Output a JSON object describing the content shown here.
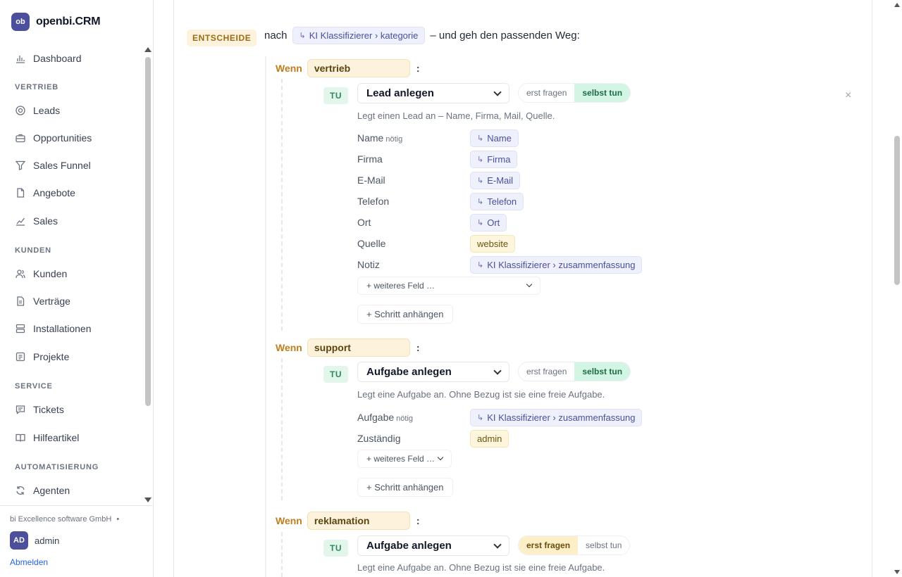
{
  "app": {
    "logo": "ob",
    "name": "openbi.CRM"
  },
  "sidebar": {
    "items": [
      {
        "label": "Dashboard",
        "icon": "bar-chart-icon"
      },
      {
        "section": "VERTRIEB"
      },
      {
        "label": "Leads",
        "icon": "target-icon"
      },
      {
        "label": "Opportunities",
        "icon": "briefcase-icon"
      },
      {
        "label": "Sales Funnel",
        "icon": "funnel-icon"
      },
      {
        "label": "Angebote",
        "icon": "document-icon"
      },
      {
        "label": "Sales",
        "icon": "trend-chart-icon"
      },
      {
        "section": "KUNDEN"
      },
      {
        "label": "Kunden",
        "icon": "users-icon"
      },
      {
        "label": "Verträge",
        "icon": "contract-icon"
      },
      {
        "label": "Installationen",
        "icon": "server-icon"
      },
      {
        "label": "Projekte",
        "icon": "project-icon"
      },
      {
        "section": "SERVICE"
      },
      {
        "label": "Tickets",
        "icon": "message-icon"
      },
      {
        "label": "Hilfeartikel",
        "icon": "book-icon"
      },
      {
        "section": "AUTOMATISIERUNG"
      },
      {
        "label": "Agenten",
        "icon": "refresh-icon"
      }
    ],
    "footer": {
      "company": "bi Excellence software GmbH",
      "company_dot": "•",
      "avatar": "AD",
      "user": "admin",
      "logout": "Abmelden"
    }
  },
  "decision": {
    "badge": "ENTSCHEIDE",
    "prefix": "nach",
    "source_chip": "KI Klassifizierer › kategorie",
    "suffix": "– und geh den passenden Weg:"
  },
  "branches": [
    {
      "wenn_label": "Wenn",
      "value": "vertrieb",
      "colon": ":",
      "tu": "TU",
      "action": "Lead anlegen",
      "mode": [
        "erst fragen",
        "selbst tun"
      ],
      "active_mode": 1,
      "close": "×",
      "desc": "Legt einen Lead an – Name, Firma, Mail, Quelle.",
      "fields": [
        {
          "label": "Name",
          "required": "nötig",
          "chip": "Name",
          "kind": "ref"
        },
        {
          "label": "Firma",
          "chip": "Firma",
          "kind": "ref"
        },
        {
          "label": "E-Mail",
          "chip": "E-Mail",
          "kind": "ref"
        },
        {
          "label": "Telefon",
          "chip": "Telefon",
          "kind": "ref"
        },
        {
          "label": "Ort",
          "chip": "Ort",
          "kind": "ref"
        },
        {
          "label": "Quelle",
          "chip": "website",
          "kind": "literal"
        },
        {
          "label": "Notiz",
          "chip": "KI Klassifizierer › zusammenfassung",
          "kind": "ref"
        }
      ],
      "more_field": "+ weiteres Feld …",
      "add_step": "+ Schritt anhängen"
    },
    {
      "wenn_label": "Wenn",
      "value": "support",
      "colon": ":",
      "tu": "TU",
      "action": "Aufgabe anlegen",
      "mode": [
        "erst fragen",
        "selbst tun"
      ],
      "active_mode": 1,
      "desc": "Legt eine Aufgabe an. Ohne Bezug ist sie eine freie Aufgabe.",
      "fields": [
        {
          "label": "Aufgabe",
          "required": "nötig",
          "chip": "KI Klassifizierer › zusammenfassung",
          "kind": "ref"
        },
        {
          "label": "Zuständig",
          "chip": "admin",
          "kind": "literal"
        }
      ],
      "more_field": "+ weiteres Feld …",
      "add_step": "+ Schritt anhängen"
    },
    {
      "wenn_label": "Wenn",
      "value": "reklamation",
      "colon": ":",
      "tu": "TU",
      "action": "Aufgabe anlegen",
      "mode": [
        "erst fragen",
        "selbst tun"
      ],
      "active_mode": 0,
      "desc": "Legt eine Aufgabe an. Ohne Bezug ist sie eine freie Aufgabe."
    }
  ],
  "ref_arrow": "↳",
  "colors": {
    "brand": "#4b4f9c",
    "wenn": "#c07d1b",
    "tu": "#2e8a5a",
    "link": "#2563eb"
  }
}
